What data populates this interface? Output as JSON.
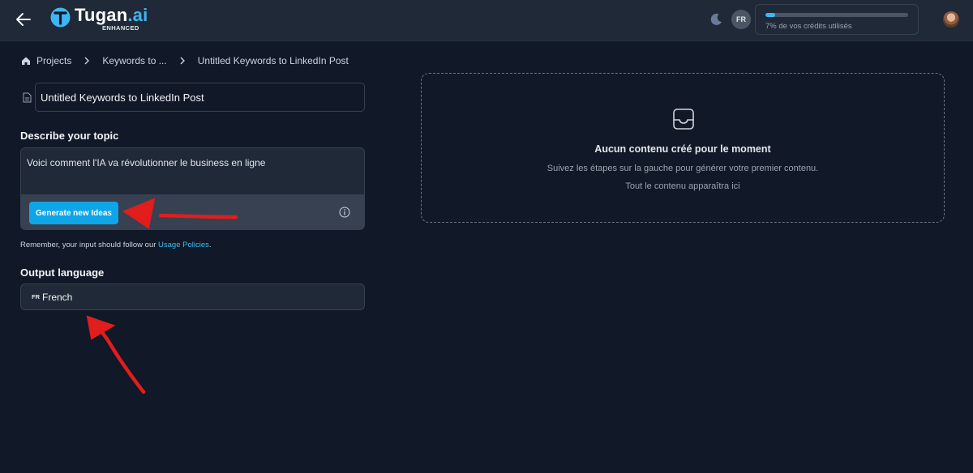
{
  "header": {
    "back_icon": "arrow-left-icon",
    "logo": {
      "name": "Tugan",
      "suffix": ".ai",
      "tagline": "ENHANCED",
      "brand_color": "#3fb6f2"
    },
    "theme_toggle_icon": "moon-icon",
    "language_badge": "FR",
    "credits": {
      "percent": 7,
      "text": "7% de vos crédits utilisés"
    },
    "avatar_icon": "user-avatar"
  },
  "breadcrumb": {
    "home_icon": "home-icon",
    "items": [
      "Projects",
      "Keywords to ...",
      "Untitled Keywords to LinkedIn Post"
    ]
  },
  "form": {
    "title_value": "Untitled Keywords to LinkedIn Post",
    "topic_label": "Describe your topic",
    "topic_value": "Voici comment l'IA va révolutionner le business en ligne",
    "generate_label": "Generate new Ideas",
    "policy_prefix": "Remember, your input should follow our ",
    "policy_link": "Usage Policies",
    "policy_suffix": ".",
    "language_label": "Output language",
    "language_code": "FR",
    "language_value": "French"
  },
  "empty_state": {
    "icon": "inbox-icon",
    "title": "Aucun contenu créé pour le moment",
    "line1": "Suivez les étapes sur la gauche pour générer votre premier contenu.",
    "line2": "Tout le contenu apparaîtra ici"
  },
  "colors": {
    "background": "#111827",
    "surface": "#1f2937",
    "accent": "#0ea5e9",
    "annotation_arrow": "#e11d1d"
  }
}
